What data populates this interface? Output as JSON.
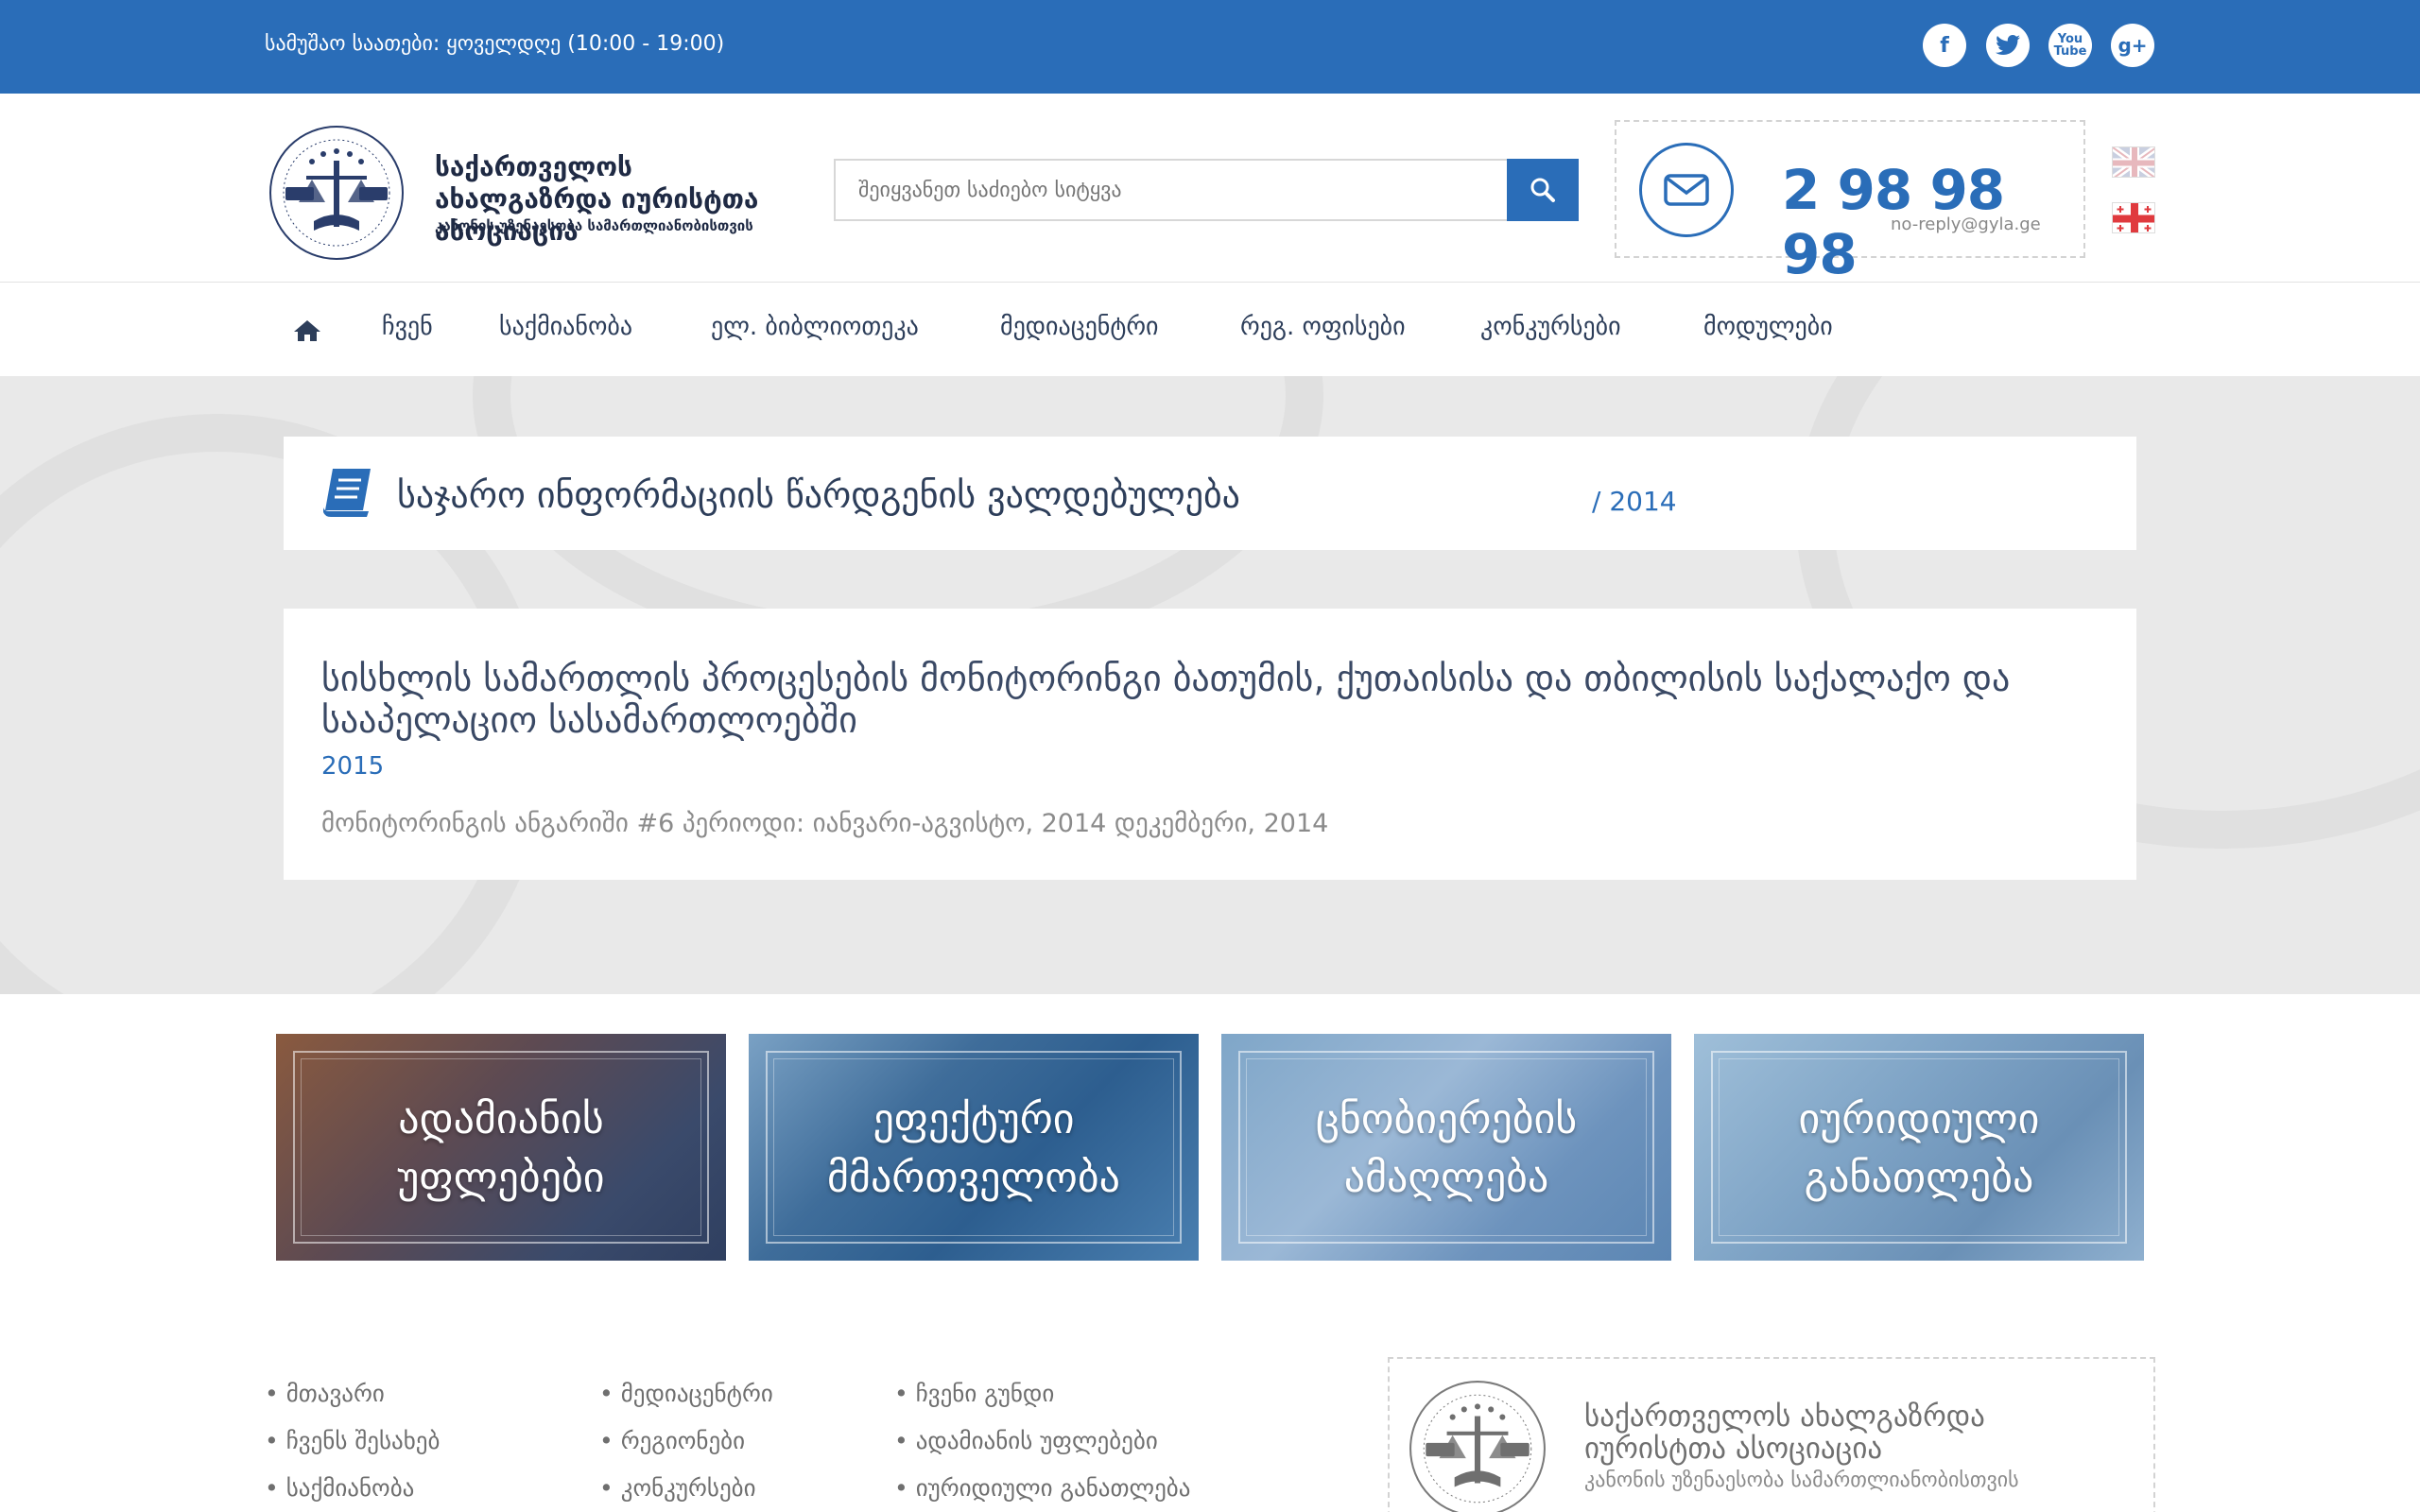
{
  "topbar": {
    "hours": "სამუშაო საათები: ყოველდღე (10:00 - 19:00)",
    "social": [
      {
        "icon": "facebook-icon",
        "glyph": "f"
      },
      {
        "icon": "twitter-icon",
        "glyph": "t"
      },
      {
        "icon": "youtube-icon",
        "glyph": "You\nTube"
      },
      {
        "icon": "google-plus-icon",
        "glyph": "g+"
      }
    ]
  },
  "header": {
    "org_name": "საქართველოს ახალგაზრდა იურისტთა ასოციაცია",
    "org_tagline": "კანონის უზენაესობა სამართლიანობისთვის",
    "search_placeholder": "შეიყვანეთ საძიებო სიტყვა",
    "phone": "2 98 98 98",
    "email": "no-reply@gyla.ge"
  },
  "nav": {
    "items": [
      "ჩვენ",
      "საქმიანობა",
      "ელ. ბიბლიოთეკა",
      "მედიაცენტრი",
      "რეგ. ოფისები",
      "კონკურსები",
      "მოდულები"
    ]
  },
  "page": {
    "title": "საჯარო ინფორმაციის წარდგენის ვალდებულება",
    "title_year": "/ 2014"
  },
  "document": {
    "heading": "სისხლის სამართლის პროცესების მონიტორინგი ბათუმის, ქუთაისისა და თბილისის საქალაქო და სააპელაციო სასამართლოებში",
    "year": "2015",
    "description": "მონიტორინგის ანგარიში #6 პერიოდი: იანვარი-აგვისტო, 2014 დეკემბერი, 2014"
  },
  "tiles": [
    {
      "label": "ადამიანის უფლებები"
    },
    {
      "label": "ეფექტური მმართველობა"
    },
    {
      "label": "ცნობიერების ამაღლება"
    },
    {
      "label": "იურიდიული განათლება"
    }
  ],
  "footer": {
    "col1": [
      "მთავარი",
      "ჩვენს შესახებ",
      "საქმიანობა"
    ],
    "col2": [
      "მედიაცენტრი",
      "რეგიონები",
      "კონკურსები"
    ],
    "col3": [
      "ჩვენი გუნდი",
      "ადამიანის უფლებები",
      "იურიდიული განათლება"
    ],
    "org_name": "საქართველოს ახალგაზრდა იურისტთა ასოციაცია",
    "org_tagline": "კანონის უზენაესობა სამართლიანობისთვის"
  },
  "colors": {
    "brand": "#2a6db8",
    "band": "#e9e9e9"
  }
}
